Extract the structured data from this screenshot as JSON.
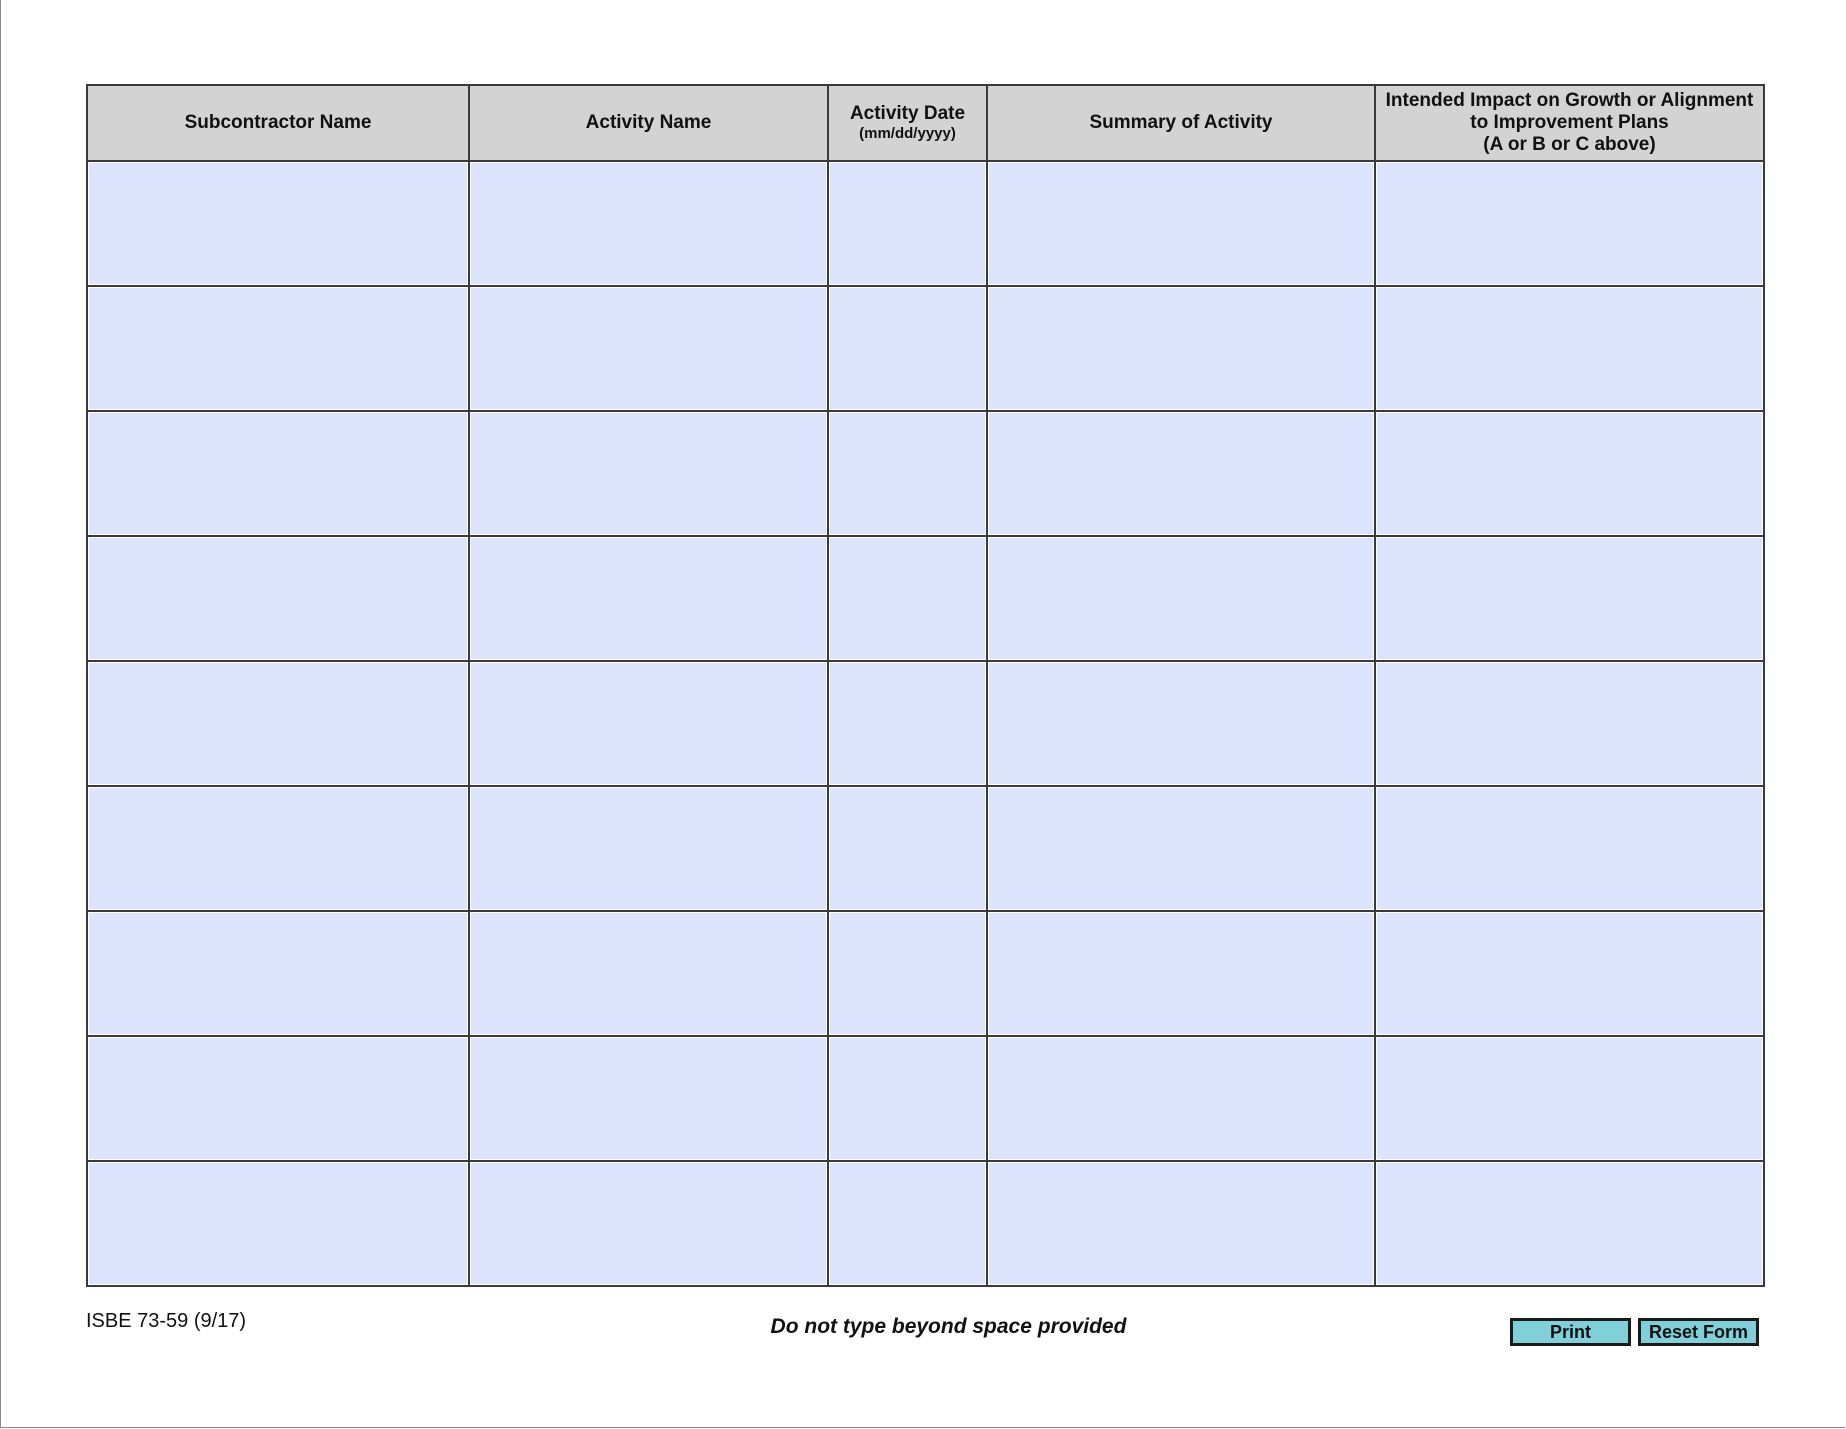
{
  "table": {
    "headers": {
      "subcontractor_name": "Subcontractor Name",
      "activity_name": "Activity Name",
      "activity_date": "Activity Date",
      "activity_date_format": "(mm/dd/yyyy)",
      "summary": "Summary of Activity",
      "impact_line1": "Intended Impact on Growth or Alignment",
      "impact_line2": "to Improvement Plans",
      "impact_line3": "(A or B or C above)"
    },
    "row_count": 9
  },
  "footer": {
    "form_id": "ISBE 73-59 (9/17)",
    "notice": "Do not type beyond space provided",
    "print_label": "Print",
    "reset_label": "Reset Form"
  },
  "colors": {
    "header_bg": "#d3d3d3",
    "field_bg": "#dce3fc",
    "button_bg": "#7fd0d8"
  }
}
